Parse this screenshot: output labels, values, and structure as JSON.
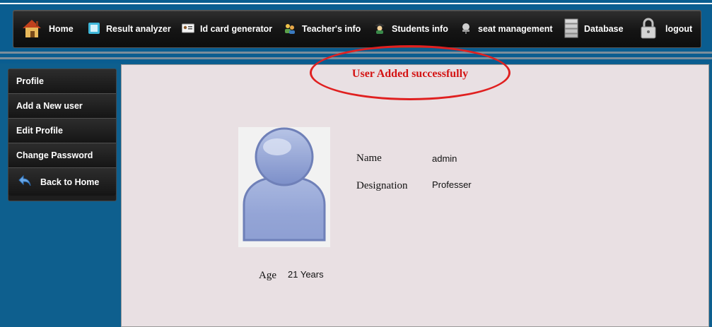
{
  "nav": {
    "items": [
      {
        "label": "Home",
        "icon": "house-icon"
      },
      {
        "label": "Result analyzer",
        "icon": "result-icon"
      },
      {
        "label": "Id card generator",
        "icon": "id-card-icon"
      },
      {
        "label": "Teacher's info",
        "icon": "teachers-icon"
      },
      {
        "label": "Students info",
        "icon": "student-icon"
      },
      {
        "label": "seat management",
        "icon": "seat-icon"
      },
      {
        "label": "Database",
        "icon": "database-icon"
      },
      {
        "label": "logout",
        "icon": "lock-icon"
      }
    ]
  },
  "sidebar": {
    "items": [
      {
        "label": "Profile"
      },
      {
        "label": "Add a New user"
      },
      {
        "label": "Edit Profile"
      },
      {
        "label": "Change Password"
      },
      {
        "label": "Back to Home",
        "icon": "back-arrow-icon"
      }
    ]
  },
  "main": {
    "message": "User Added successfully",
    "profile": {
      "name_label": "Name",
      "name_value": "admin",
      "designation_label": "Designation",
      "designation_value": "Professer",
      "age_label": "Age",
      "age_value": "21 Years"
    }
  },
  "colors": {
    "page_blue": "#0a5d90",
    "panel_bg": "#e9e0e3",
    "message_red": "#d41414"
  }
}
